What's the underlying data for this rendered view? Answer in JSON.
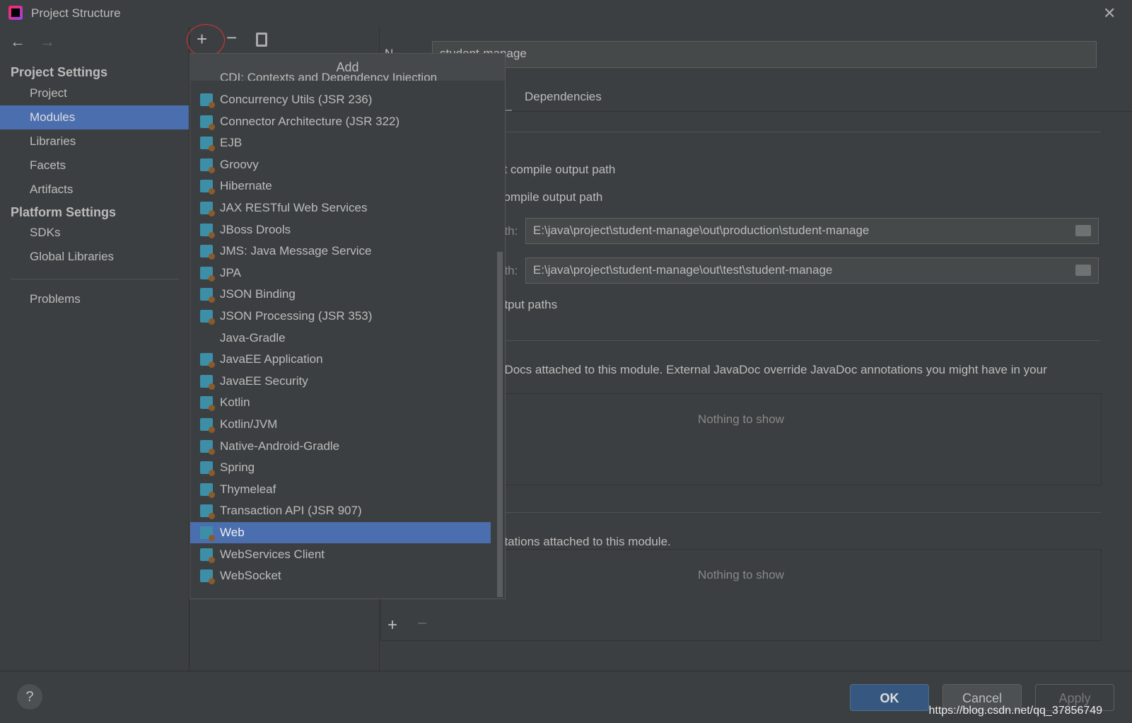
{
  "window": {
    "title": "Project Structure"
  },
  "sidebar": {
    "section1": "Project Settings",
    "items1": [
      "Project",
      "Modules",
      "Libraries",
      "Facets",
      "Artifacts"
    ],
    "section2": "Platform Settings",
    "items2": [
      "SDKs",
      "Global Libraries"
    ],
    "problems": "Problems",
    "selected": "Modules"
  },
  "main": {
    "name_label": "N",
    "name_value": "student-manage",
    "tab": "Dependencies",
    "inherit": "ct compile output path",
    "use": "compile output path",
    "out_label": "ath:",
    "out_path": "E:\\java\\project\\student-manage\\out\\production\\student-manage",
    "test_label": "ath:",
    "test_path": "E:\\java\\project\\student-manage\\out\\test\\student-manage",
    "exclude": "utput paths",
    "javadoc": "aDocs attached to this module. External JavaDoc override JavaDoc annotations you might have in your",
    "nothing1": "Nothing to show",
    "annot": "otations attached to this module.",
    "nothing2": "Nothing to show"
  },
  "popup": {
    "title": "Add",
    "cut_item": "CDI: Contexts and Dependency Injection",
    "items": [
      "Concurrency Utils (JSR 236)",
      "Connector Architecture (JSR 322)",
      "EJB",
      "Groovy",
      "Hibernate",
      "JAX RESTful Web Services",
      "JBoss Drools",
      "JMS: Java Message Service",
      "JPA",
      "JSON Binding",
      "JSON Processing (JSR 353)",
      "Java-Gradle",
      "JavaEE Application",
      "JavaEE Security",
      "Kotlin",
      "Kotlin/JVM",
      "Native-Android-Gradle",
      "Spring",
      "Thymeleaf",
      "Transaction API (JSR 907)",
      "Web",
      "WebServices Client",
      "WebSocket"
    ],
    "selected": "Web"
  },
  "buttons": {
    "ok": "OK",
    "cancel": "Cancel",
    "apply": "Apply",
    "help": "?"
  },
  "watermark": "https://blog.csdn.net/qq_37856749",
  "colors": {
    "background": "#3c3f41",
    "selection": "#4b6eaf",
    "ok": "#365880"
  }
}
